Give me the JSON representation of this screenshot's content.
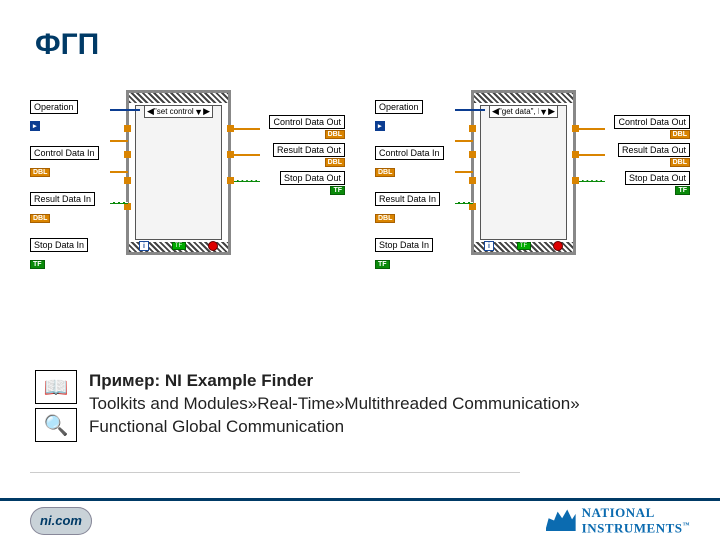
{
  "title": "ФГП",
  "left": {
    "case_label": "\"set control data\"",
    "inputs": [
      {
        "label": "Operation",
        "type": "OP"
      },
      {
        "label": "Control Data In",
        "type": "DBL"
      },
      {
        "label": "Result Data In",
        "type": "DBL"
      },
      {
        "label": "Stop Data In",
        "type": "TF"
      }
    ],
    "outputs": [
      {
        "label": "Control Data Out",
        "type": "DBL"
      },
      {
        "label": "Result Data Out",
        "type": "DBL"
      },
      {
        "label": "Stop Data Out",
        "type": "TF"
      }
    ]
  },
  "right": {
    "case_label": "\"get data\", Default",
    "inputs": [
      {
        "label": "Operation",
        "type": "OP"
      },
      {
        "label": "Control Data In",
        "type": "DBL"
      },
      {
        "label": "Result Data In",
        "type": "DBL"
      },
      {
        "label": "Stop Data In",
        "type": "TF"
      }
    ],
    "outputs": [
      {
        "label": "Control Data Out",
        "type": "DBL"
      },
      {
        "label": "Result Data Out",
        "type": "DBL"
      },
      {
        "label": "Stop Data Out",
        "type": "TF"
      }
    ]
  },
  "tip": {
    "header": "Пример: NI Example Finder",
    "line2": "Toolkits and Modules»Real-Time»Multithreaded Communication»",
    "line3": "Functional Global Communication"
  },
  "footer": {
    "site": "ni.com",
    "brand1": "NATIONAL",
    "brand2": "INSTRUMENTS",
    "tm": "™"
  },
  "glyphs": {
    "loop_i": "i",
    "tf": "TF",
    "dbl": "DBL",
    "op": "▸"
  }
}
